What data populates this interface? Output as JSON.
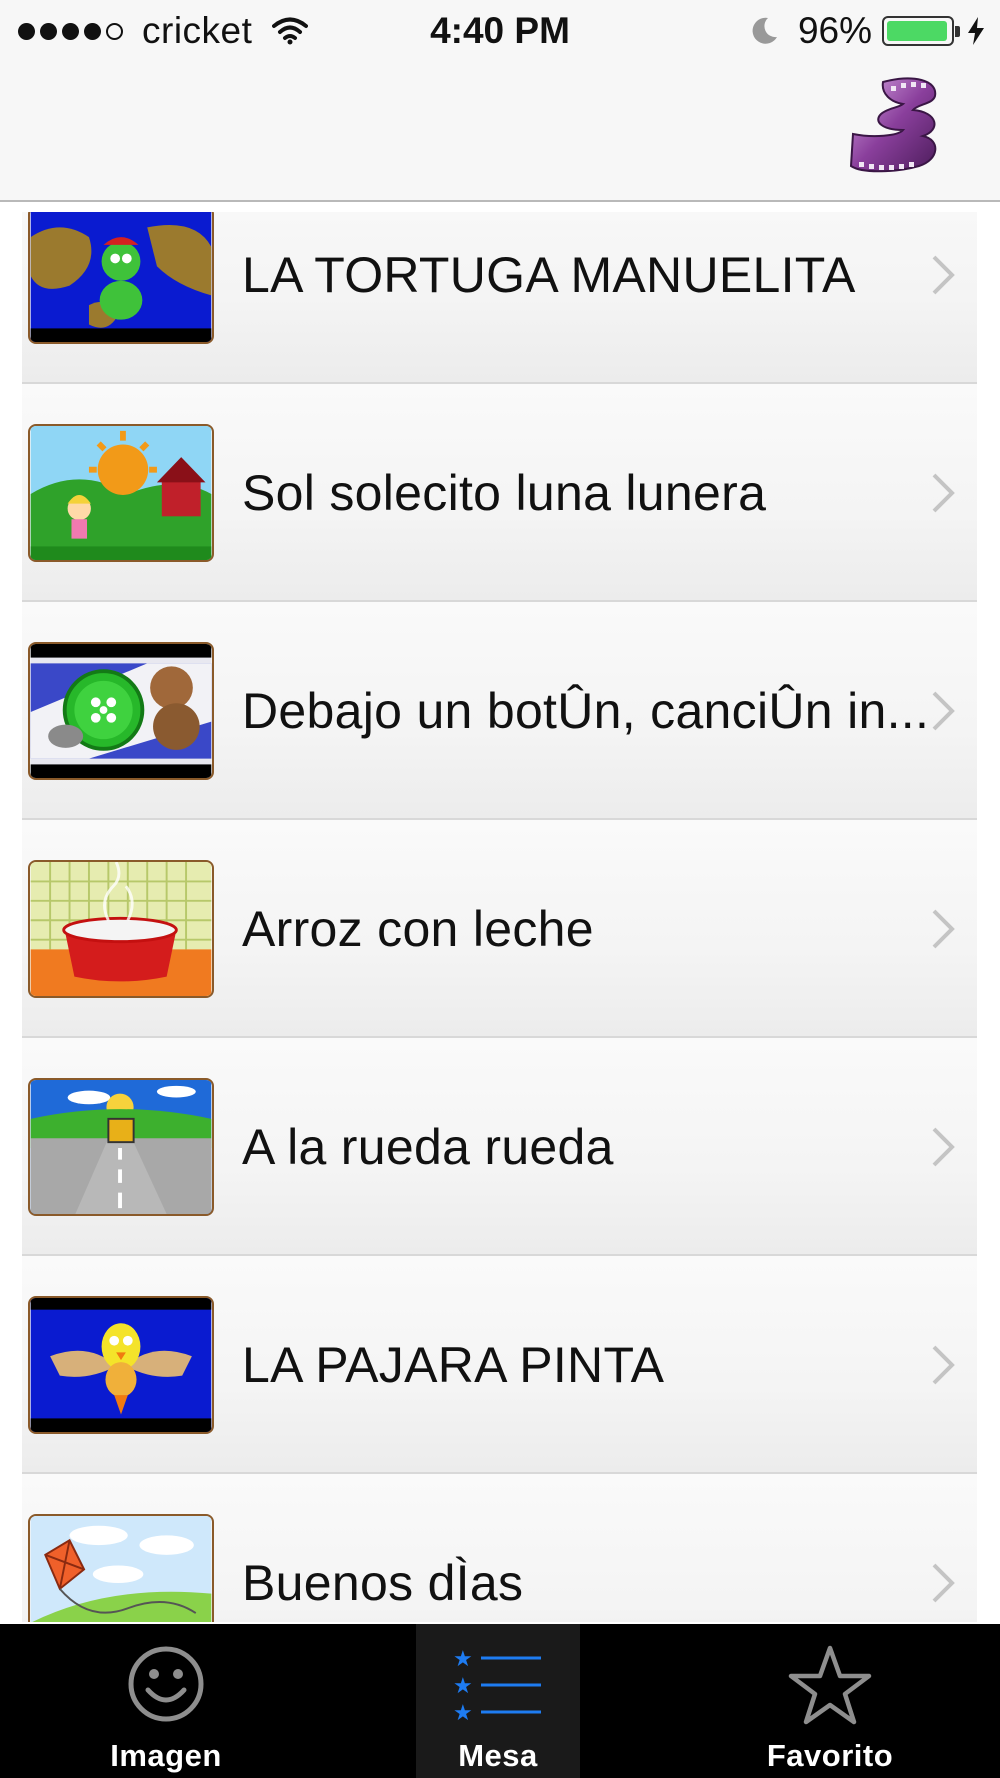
{
  "status_bar": {
    "carrier": "cricket",
    "time": "4:40 PM",
    "battery_percent": "96%",
    "battery_level": 0.96
  },
  "nav_bar": {
    "icon": "film-reel-icon"
  },
  "songs": [
    {
      "title": "LA TORTUGA MANUELITA",
      "thumb": "turtle-thumbnail"
    },
    {
      "title": "Sol solecito luna lunera",
      "thumb": "sun-house-thumbnail"
    },
    {
      "title": "Debajo un botÛn, canciÛn in...",
      "thumb": "button-thumbnail"
    },
    {
      "title": "Arroz con leche",
      "thumb": "rice-bowl-thumbnail"
    },
    {
      "title": "A la rueda rueda",
      "thumb": "road-bus-thumbnail"
    },
    {
      "title": "LA PAJARA PINTA",
      "thumb": "bird-thumbnail"
    },
    {
      "title": "Buenos dÌas",
      "thumb": "kite-thumbnail"
    }
  ],
  "tabs": [
    {
      "label": "Imagen",
      "icon": "smiley-icon",
      "active": false
    },
    {
      "label": "Mesa",
      "icon": "starred-list-icon",
      "active": true
    },
    {
      "label": "Favorito",
      "icon": "star-icon",
      "active": false
    }
  ],
  "colors": {
    "active_tab_icon": "#1e7cf2",
    "battery_fill": "#4cd964",
    "thumb_border": "#8a5a2a"
  }
}
